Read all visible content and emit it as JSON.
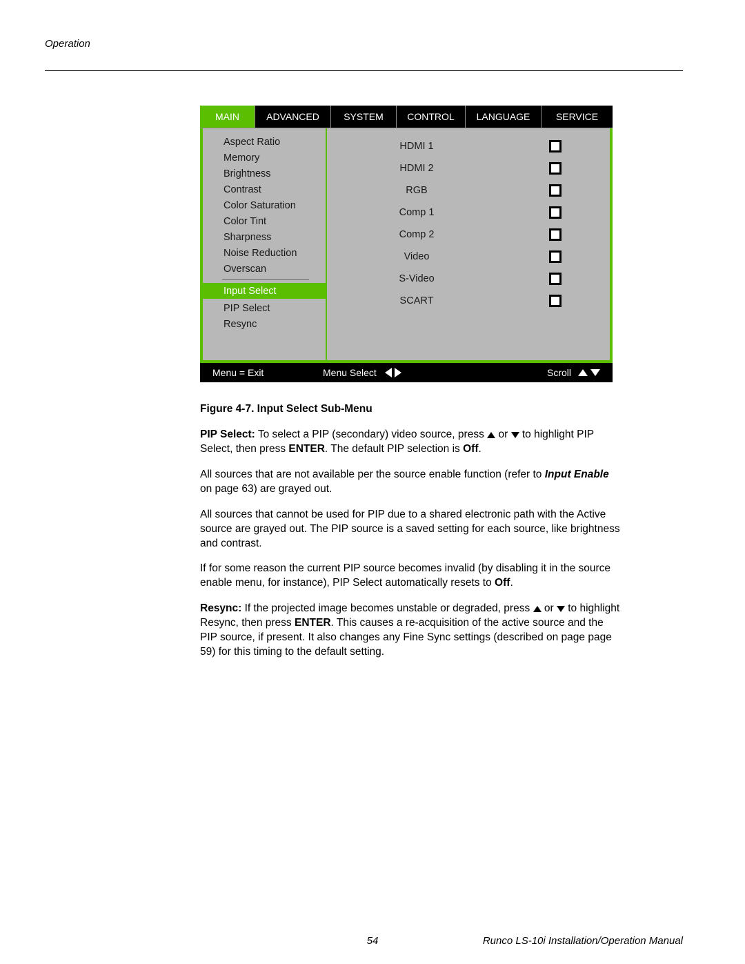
{
  "header": {
    "section": "Operation"
  },
  "osd": {
    "tabs": [
      "MAIN",
      "ADVANCED",
      "SYSTEM",
      "CONTROL",
      "LANGUAGE",
      "SERVICE"
    ],
    "activeTabIndex": 0,
    "sidebar": [
      "Aspect Ratio",
      "Memory",
      "Brightness",
      "Contrast",
      "Color Saturation",
      "Color Tint",
      "Sharpness",
      "Noise Reduction",
      "Overscan",
      "Input Select",
      "PIP Select",
      "Resync"
    ],
    "sidebarHighlightedIndex": 9,
    "sidebarDividerAfterIndex": 8,
    "inputs": [
      "HDMI 1",
      "HDMI 2",
      "RGB",
      "Comp 1",
      "Comp 2",
      "Video",
      "S-Video",
      "SCART"
    ],
    "footer": {
      "left": "Menu = Exit",
      "mid": "Menu Select",
      "right": "Scroll"
    }
  },
  "caption": "Figure 4-7. Input Select Sub-Menu",
  "body": {
    "p1_lead": "PIP Select:",
    "p1_a": " To select a PIP (secondary) video source, press ",
    "p1_b": " or ",
    "p1_c": " to highlight PIP Select, then press ",
    "p1_enter": "ENTER",
    "p1_d": ". The default PIP selection is ",
    "p1_off": "Off",
    "p1_e": ".",
    "p2_a": "All sources that are not available per the source enable function (refer to ",
    "p2_link": "Input Enable",
    "p2_b": " on page 63) are grayed out.",
    "p3": "All sources that cannot be used for PIP due to a shared electronic path with the Active source are grayed out. The PIP source is a saved setting for each source, like brightness and contrast.",
    "p4_a": "If for some reason the current PIP source becomes invalid (by disabling it in the source enable menu, for instance), PIP Select automatically resets to ",
    "p4_off": "Off",
    "p4_b": ".",
    "p5_lead": "Resync:",
    "p5_a": " If the projected image becomes unstable or degraded, press ",
    "p5_b": " or ",
    "p5_c": " to highlight Resync, then press ",
    "p5_enter": "ENTER",
    "p5_d": ". This causes a re-acquisition of the active source and the PIP source, if present. It also changes any Fine Sync settings (described on page page 59) for this timing to the default setting."
  },
  "footer": {
    "page": "54",
    "manual": "Runco LS-10i Installation/Operation Manual"
  }
}
